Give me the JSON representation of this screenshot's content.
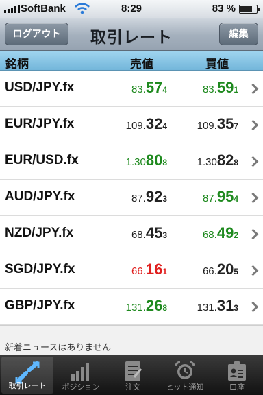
{
  "status": {
    "carrier": "SoftBank",
    "time": "8:29",
    "battery": "83 %",
    "battery_level": 0.83
  },
  "nav": {
    "title": "取引レート",
    "left_button": "ログアウト",
    "right_button": "編集"
  },
  "columns": {
    "symbol": "銘柄",
    "bid": "売値",
    "ask": "買値"
  },
  "rows": [
    {
      "pair": "USD/JPY.fx",
      "bid": {
        "a": "83.",
        "b": "57",
        "c": "4",
        "color": "#1f8a1f"
      },
      "ask": {
        "a": "83.",
        "b": "59",
        "c": "1",
        "color": "#1f8a1f"
      }
    },
    {
      "pair": "EUR/JPY.fx",
      "bid": {
        "a": "109.",
        "b": "32",
        "c": "4",
        "color": "#222222"
      },
      "ask": {
        "a": "109.",
        "b": "35",
        "c": "7",
        "color": "#222222"
      }
    },
    {
      "pair": "EUR/USD.fx",
      "bid": {
        "a": "1.30",
        "b": "80",
        "c": "8",
        "color": "#1f8a1f"
      },
      "ask": {
        "a": "1.30",
        "b": "82",
        "c": "8",
        "color": "#222222"
      }
    },
    {
      "pair": "AUD/JPY.fx",
      "bid": {
        "a": "87.",
        "b": "92",
        "c": "3",
        "color": "#222222"
      },
      "ask": {
        "a": "87.",
        "b": "95",
        "c": "4",
        "color": "#1f8a1f"
      }
    },
    {
      "pair": "NZD/JPY.fx",
      "bid": {
        "a": "68.",
        "b": "45",
        "c": "3",
        "color": "#222222"
      },
      "ask": {
        "a": "68.",
        "b": "49",
        "c": "2",
        "color": "#1f8a1f"
      }
    },
    {
      "pair": "SGD/JPY.fx",
      "bid": {
        "a": "66.",
        "b": "16",
        "c": "1",
        "color": "#e0201f"
      },
      "ask": {
        "a": "66.",
        "b": "20",
        "c": "5",
        "color": "#222222"
      }
    },
    {
      "pair": "GBP/JPY.fx",
      "bid": {
        "a": "131.",
        "b": "26",
        "c": "8",
        "color": "#1f8a1f"
      },
      "ask": {
        "a": "131.",
        "b": "31",
        "c": "3",
        "color": "#222222"
      }
    }
  ],
  "news": "新着ニュースはありません",
  "tabs": [
    {
      "label": "取引レート",
      "icon": "rate-arrows-icon",
      "active": true
    },
    {
      "label": "ポジション",
      "icon": "bar-chart-icon",
      "active": false
    },
    {
      "label": "注文",
      "icon": "order-document-icon",
      "active": false
    },
    {
      "label": "ヒット通知",
      "icon": "alarm-clock-icon",
      "active": false
    },
    {
      "label": "口座",
      "icon": "account-card-icon",
      "active": false
    }
  ]
}
